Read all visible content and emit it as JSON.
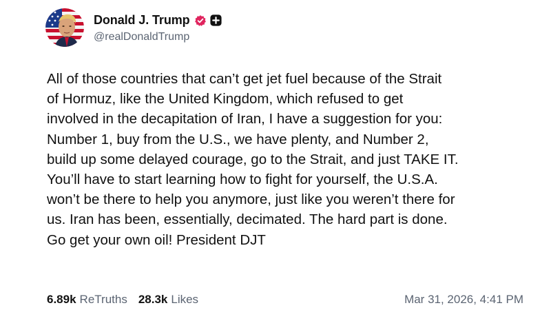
{
  "author": {
    "display_name": "Donald J. Trump",
    "handle": "@realDonaldTrump",
    "avatar_icon": "flag-portrait-avatar",
    "verified_icon": "verified-badge-icon",
    "verified_color": "#e0245e",
    "plus_icon": "plus-badge-icon"
  },
  "post": {
    "lines": [
      "All of those countries that can’t get jet fuel because of the Strait",
      "of Hormuz, like the United Kingdom, which refused to get",
      "involved in the decapitation of Iran, I have a suggestion for you:",
      "Number 1, buy from the U.S., we have plenty, and Number 2,",
      "build up some delayed courage, go to the Strait, and just TAKE IT.",
      "You’ll have to start learning how to fight for yourself, the U.S.A.",
      "won’t be there to help you anymore, just like you weren’t there for",
      "us. Iran has been, essentially, decimated. The hard part is done.",
      "Go get your own oil! President DJT"
    ]
  },
  "stats": {
    "retruths_count": "6.89k",
    "retruths_label": "ReTruths",
    "likes_count": "28.3k",
    "likes_label": "Likes"
  },
  "timestamp": "Mar 31, 2026, 4:41 PM"
}
